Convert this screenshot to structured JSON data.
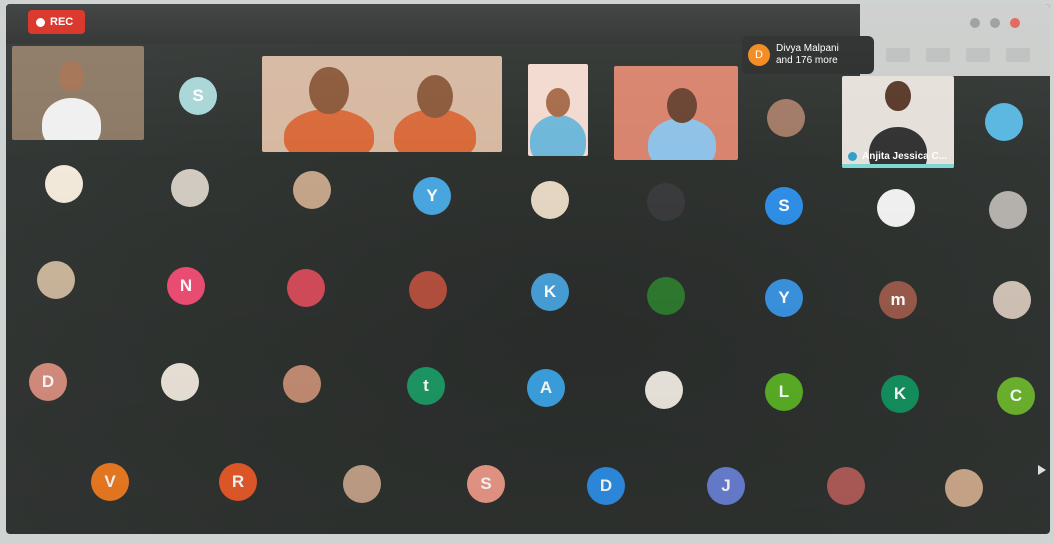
{
  "recording": {
    "label": "REC"
  },
  "participants_pill": {
    "avatar_letter": "D",
    "line1": "Divya Malpani",
    "line2": "and 176 more"
  },
  "speaker": {
    "name": "Anjita Jessica C..."
  },
  "video_tiles": [
    {
      "id": "video-tile-1",
      "bg": "#8d7a66",
      "shirt": "#f0f0f0",
      "skin": "#a57456"
    },
    {
      "id": "video-tile-2",
      "bg": "#d7b9a2",
      "shirt": "#d96a3a",
      "skin": "#8c5a3c"
    },
    {
      "id": "video-tile-3",
      "bg": "#f3dad0",
      "shirt": "#6fb7d9",
      "skin": "#a76c4b"
    },
    {
      "id": "video-tile-4",
      "bg": "#d8846e",
      "shirt": "#8fc2e8",
      "skin": "#6b4432"
    },
    {
      "id": "video-tile-5",
      "bg": "#e5e0da",
      "shirt": "#333333",
      "skin": "#5a3a2a"
    }
  ],
  "avatars": [
    {
      "letter": "S",
      "color": "#a9d6d8"
    },
    {
      "letter": "",
      "color": "#f2e9da"
    },
    {
      "letter": "",
      "color": "#d1cbc1"
    },
    {
      "letter": "",
      "color": "#c5a58a"
    },
    {
      "letter": "",
      "color": "#e6d7c3"
    },
    {
      "letter": "",
      "color": "#3a3b3d"
    },
    {
      "letter": "",
      "color": "#e8e0d2"
    },
    {
      "letter": "Y",
      "color": "#49a6df"
    },
    {
      "letter": "",
      "color": "#a27b67"
    },
    {
      "letter": "",
      "color": "#5ab7e0"
    },
    {
      "letter": "S",
      "color": "#2f8fe6"
    },
    {
      "letter": "",
      "color": "#f1f1f1"
    },
    {
      "letter": "",
      "color": "#b6b2ad"
    },
    {
      "letter": "",
      "color": "#cbb79c"
    },
    {
      "letter": "N",
      "color": "#ef4e74"
    },
    {
      "letter": "",
      "color": "#d44c5a"
    },
    {
      "letter": "",
      "color": "#b5503f"
    },
    {
      "letter": "K",
      "color": "#48a0d8"
    },
    {
      "letter": "",
      "color": "#2e7a2f"
    },
    {
      "letter": "Y",
      "color": "#3b93e0"
    },
    {
      "letter": "m",
      "color": "#9a5a4a"
    },
    {
      "letter": "",
      "color": "#d3c4b8"
    },
    {
      "letter": "D",
      "color": "#d98f7f"
    },
    {
      "letter": "",
      "color": "#efe7dc"
    },
    {
      "letter": "",
      "color": "#c58e74"
    },
    {
      "letter": "t",
      "color": "#1d9a66"
    },
    {
      "letter": "A",
      "color": "#3ca3e3"
    },
    {
      "letter": "",
      "color": "#eeeae2"
    },
    {
      "letter": "L",
      "color": "#5bb026"
    },
    {
      "letter": "K",
      "color": "#149260"
    },
    {
      "letter": "C",
      "color": "#6eb62e"
    },
    {
      "letter": "V",
      "color": "#f27d22"
    },
    {
      "letter": "R",
      "color": "#ea5b2a"
    },
    {
      "letter": "",
      "color": "#c7a48b"
    },
    {
      "letter": "S",
      "color": "#ee9a8a"
    },
    {
      "letter": "D",
      "color": "#2f8fe6"
    },
    {
      "letter": "J",
      "color": "#6a82d6"
    },
    {
      "letter": "",
      "color": "#b35e5b"
    },
    {
      "letter": "",
      "color": "#d2ad8e"
    }
  ]
}
